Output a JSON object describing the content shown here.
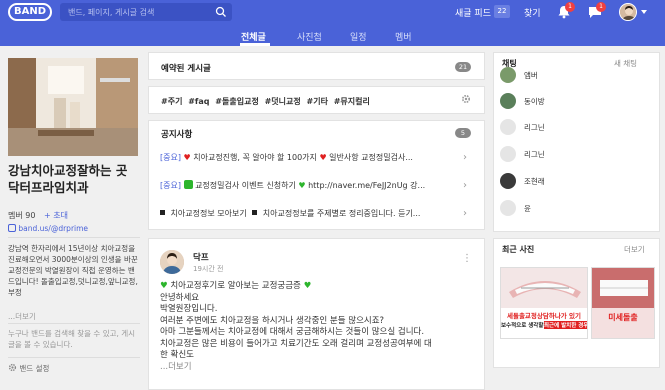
{
  "header": {
    "logo": "BAND",
    "search_placeholder": "밴드, 페이지, 게시글 검색",
    "new_feed_label": "새글 피드",
    "new_feed_count": "22",
    "find_label": "찾기",
    "notification_badge": "1",
    "chat_badge": "1"
  },
  "subnav": {
    "tabs": [
      "전체글",
      "사진첩",
      "일정",
      "멤버"
    ],
    "active_tab": "전체글"
  },
  "band": {
    "name": "강남치아교정잘하는 곳 닥터프라임치과",
    "members": "멤버 90",
    "invite": "+ 초대",
    "url": "band.us/@drprime",
    "description": "강남역 한자리에서 15년이상 치아교정을 진료해오면서 3000분이상의 인생을 바꾼 교정전문의 박열원장이 직접 운영하는 밴드입니다! 돌출입교정,덧니교정,앞니교정,부정",
    "more": "...더보기",
    "search_note": "누구나 밴드를 검색해 찾을 수 있고, 게시글을 볼 수 있습니다.",
    "settings_label": "밴드 설정"
  },
  "reserved": {
    "title": "예약된 게시글",
    "count": "21"
  },
  "tags": "#주기 #faq #돌출입교정 #덧니교정 #기타 #뮤지컬리",
  "notices": {
    "title": "공지사항",
    "count": "5",
    "items": [
      {
        "tag": "[중요]",
        "text": "치아교정진행, 꼭 알아야 할 100가지",
        "text2": "일반사항 교정정밀검사..."
      },
      {
        "tag": "[중요]",
        "text": "교정정밀검사 이벤트 신청하기",
        "text2": "http://naver.me/FeJJ2nUg 강..."
      },
      {
        "tag": "",
        "text": "치아교정정보 모아보기",
        "text2": "치아교정정보를 주제별로 정리중입니다. 듣기..."
      }
    ]
  },
  "post": {
    "author": "닥프",
    "time": "19시간 전",
    "lines": [
      "치아교정후기로 알아보는 교정궁금증",
      "안녕하세요",
      "박열원장입니다.",
      "여러분 주변에도 치아교정을 하시거나 생각중인 분들 많으시죠?",
      "아마 그분들께서는 치아교정에 대해서 궁금해하시는 것들이 많으실 겁니다.",
      "치아교정은 많은 비용이 들어가고 치료기간도 오래 걸리며 교정성공여부에 대",
      "한 확신도",
      "...더보기"
    ]
  },
  "chat": {
    "title": "채팅",
    "new_chat": "새 채팅",
    "items": [
      "앰버",
      "동이방",
      "리그닌",
      "리그닌",
      "조현래",
      "윤"
    ]
  },
  "photos": {
    "title": "최근 사진",
    "more": "더보기",
    "thumb_labels": [
      "세돌출교정상담하나가 있기",
      "보수적으로 생각할경",
      "최근에 발치한 경우",
      "미세돌출"
    ]
  },
  "colors": {
    "brand": "#4a62d8",
    "heart": "#e02020",
    "green": "#2db52d"
  }
}
